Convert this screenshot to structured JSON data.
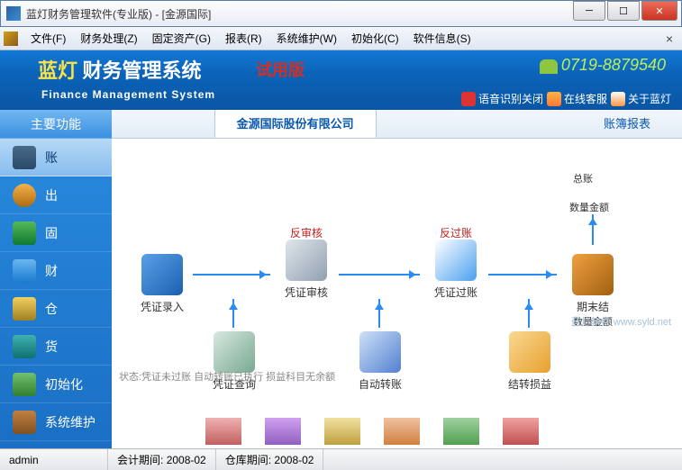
{
  "window": {
    "title": "蓝灯财务管理软件(专业版) - [金源国际]"
  },
  "menus": [
    "文件(F)",
    "财务处理(Z)",
    "固定资产(G)",
    "报表(R)",
    "系统维护(W)",
    "初始化(C)",
    "软件信息(S)"
  ],
  "banner": {
    "brand_left": "蓝灯",
    "brand_right": "财务管理系统",
    "trial": "试用版",
    "english": "Finance Management System",
    "phone": "0719-8879540",
    "links": {
      "voice": "语音识别关闭",
      "support": "在线客服",
      "about": "关于蓝灯"
    }
  },
  "sidebar": {
    "header": "主要功能",
    "items": [
      "账",
      "出",
      "固",
      "财",
      "仓",
      "货",
      "初始化",
      "系统维护"
    ]
  },
  "tabs": {
    "company": "金源国际股份有限公司",
    "report": "账簿报表"
  },
  "flow": {
    "entry": "凭证录入",
    "audit": "凭证审核",
    "audit_top": "反审核",
    "post": "凭证过账",
    "post_top": "反过账",
    "general_ledger": "总账",
    "qty_amount": "数量金额",
    "period_end": "期末结",
    "qty_amount2": "数量金额",
    "query": "凭证查询",
    "auto": "自动转账",
    "profit": "结转损益"
  },
  "status_hint": "状态:凭证未过账  自动转账已执行  损益科目无余额",
  "watermark": "蓝灯软件    www.syld.net",
  "statusbar": {
    "user": "admin",
    "period_label": "会计期间:",
    "period": "2008-02",
    "stock_label": "仓库期间:",
    "stock": "2008-02"
  }
}
